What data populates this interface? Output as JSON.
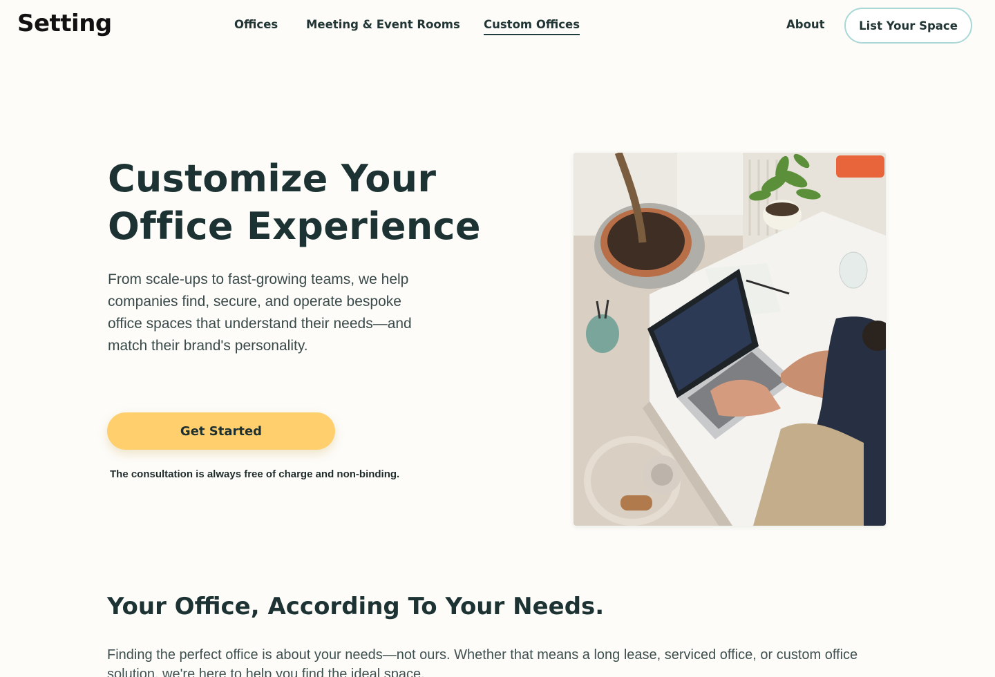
{
  "brand": {
    "logo": "Setting"
  },
  "nav": {
    "offices": "Offices",
    "meeting_rooms": "Meeting & Event Rooms",
    "custom_offices": "Custom Offices",
    "about": "About",
    "list_space": "List Your Space"
  },
  "hero": {
    "title_line1": "Customize Your",
    "title_line2": "Office Experience",
    "description": "From scale-ups to fast-growing teams, we help companies find, secure, and operate bespoke office spaces that understand their needs—and match their brand's personality.",
    "cta": "Get Started",
    "note": "The consultation is always free of charge and non-binding."
  },
  "section": {
    "title": "Your Office, According To Your Needs.",
    "body": "Finding the perfect office is about your needs—not ours. Whether that means a long lease, serviced office, or custom office solution, we're here to help you find the ideal space."
  },
  "colors": {
    "background": "#fdfcf9",
    "cta": "#ffcf6e",
    "outline_button": "#a9d7d6",
    "heading": "#1d3333"
  }
}
